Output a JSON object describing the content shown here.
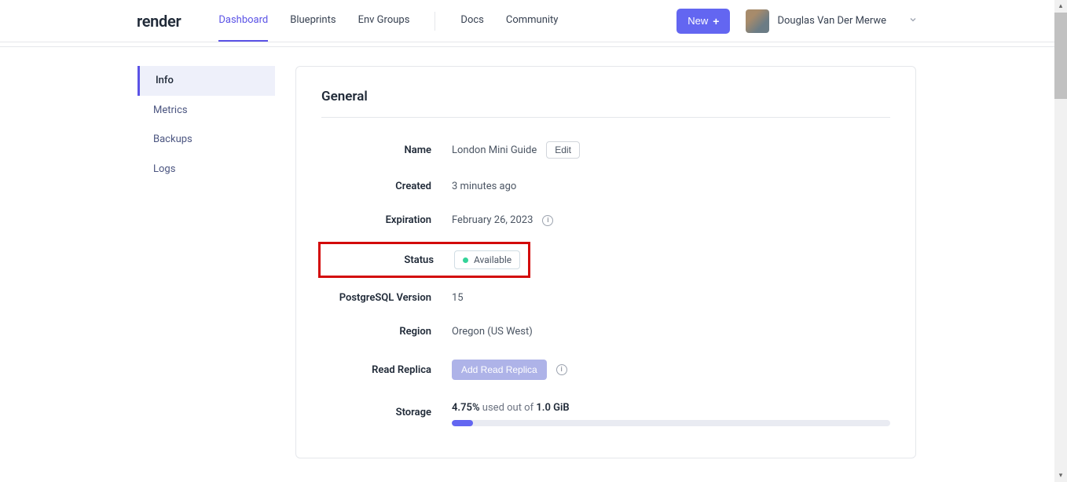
{
  "header": {
    "logo": "render",
    "nav": {
      "dashboard": "Dashboard",
      "blueprints": "Blueprints",
      "envgroups": "Env Groups",
      "docs": "Docs",
      "community": "Community"
    },
    "new_button": "New",
    "username": "Douglas Van Der Merwe"
  },
  "sidebar": {
    "items": [
      {
        "label": "Info",
        "active": true
      },
      {
        "label": "Metrics",
        "active": false
      },
      {
        "label": "Backups",
        "active": false
      },
      {
        "label": "Logs",
        "active": false
      }
    ]
  },
  "panel": {
    "title": "General",
    "fields": {
      "name": {
        "label": "Name",
        "value": "London Mini Guide",
        "edit": "Edit"
      },
      "created": {
        "label": "Created",
        "value": "3 minutes ago"
      },
      "expiration": {
        "label": "Expiration",
        "value": "February 26, 2023"
      },
      "status": {
        "label": "Status",
        "value": "Available"
      },
      "pgversion": {
        "label": "PostgreSQL Version",
        "value": "15"
      },
      "region": {
        "label": "Region",
        "value": "Oregon (US West)"
      },
      "readreplica": {
        "label": "Read Replica",
        "button": "Add Read Replica"
      },
      "storage": {
        "label": "Storage",
        "percent": "4.75%",
        "used_text": " used out of ",
        "total": "1.0 GiB"
      }
    }
  }
}
